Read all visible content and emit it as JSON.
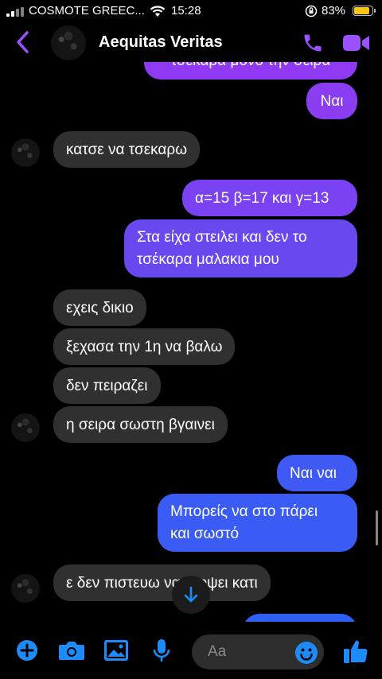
{
  "status_bar": {
    "carrier": "COSMOTE GREEC...",
    "time": "15:28",
    "battery": "83%"
  },
  "header": {
    "contact_name": "Aequitas Veritas",
    "accent": "#9b51ff"
  },
  "messages": [
    {
      "side": "out",
      "text": "τσέκαρα μόνο την σειρά"
    },
    {
      "side": "out",
      "text": "Ναι"
    },
    {
      "side": "in",
      "text": "κατσε να τσεκαρω"
    },
    {
      "side": "out",
      "text": "α=15 β=17 και γ=13"
    },
    {
      "side": "out",
      "line1": "Στα είχα στειλει και δεν το",
      "line2": "τσέκαρα μαλακια μου"
    },
    {
      "side": "in",
      "text": "εχεις δικιο"
    },
    {
      "side": "in",
      "text": "ξεχασα την 1η να βαλω"
    },
    {
      "side": "in",
      "text": "δεν πειραζει"
    },
    {
      "side": "in",
      "text": "η σειρα σωστη βγαινει"
    },
    {
      "side": "out",
      "text": "Ναι ναι"
    },
    {
      "side": "out",
      "line1": "Μπορείς να στο πάρει",
      "line2": "και σωστό"
    },
    {
      "side": "in",
      "text": "ε δεν πιστευω να εκοψει κατι"
    }
  ],
  "composer": {
    "placeholder": "Aa"
  },
  "colors": {
    "purple": "#8a3cf0",
    "violet": "#6a48f0",
    "blue": "#3a5cf5",
    "icon_blue": "#1d8cf8"
  },
  "icons": [
    "back-icon",
    "phone-icon",
    "video-camera-icon",
    "plus-icon",
    "camera-icon",
    "image-icon",
    "microphone-icon",
    "emoji-icon",
    "thumbs-up-icon",
    "arrow-down-icon"
  ]
}
